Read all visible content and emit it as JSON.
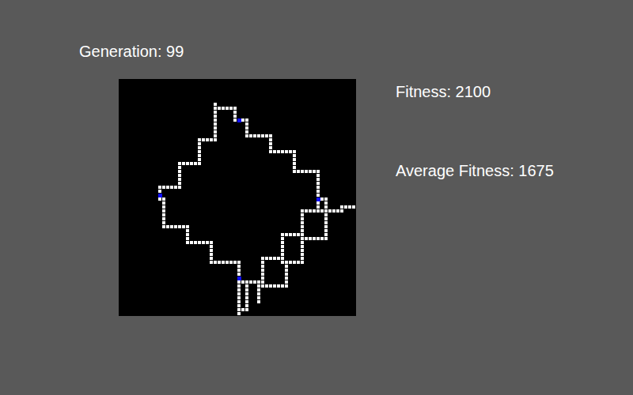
{
  "header": {
    "generation": "Generation: 99"
  },
  "stats": [
    {
      "label": "Fitness: 2100"
    },
    {
      "label": "Average Fitness: 1675"
    }
  ],
  "board": {
    "cols": 60,
    "rows": 60,
    "trails": [
      [
        [
          24,
          6
        ],
        [
          24,
          7
        ],
        [
          29,
          7
        ],
        [
          29,
          10
        ],
        [
          32,
          10
        ],
        [
          32,
          14
        ],
        [
          38,
          14
        ],
        [
          38,
          18
        ],
        [
          44,
          18
        ],
        [
          44,
          23
        ],
        [
          50,
          23
        ],
        [
          50,
          33
        ],
        [
          56,
          33
        ],
        [
          56,
          32
        ],
        [
          59,
          32
        ]
      ],
      [
        [
          24,
          7
        ],
        [
          24,
          15
        ],
        [
          20,
          15
        ],
        [
          20,
          21
        ],
        [
          15,
          21
        ],
        [
          15,
          27
        ],
        [
          10,
          27
        ],
        [
          10,
          30
        ],
        [
          11,
          30
        ],
        [
          11,
          37
        ],
        [
          17,
          37
        ],
        [
          17,
          41
        ],
        [
          23,
          41
        ],
        [
          23,
          46
        ],
        [
          30,
          46
        ],
        [
          30,
          51
        ]
      ],
      [
        [
          30,
          51
        ],
        [
          36,
          51
        ]
      ],
      [
        [
          30,
          51
        ],
        [
          30,
          59
        ]
      ],
      [
        [
          32,
          51
        ],
        [
          32,
          58
        ],
        [
          31,
          58
        ]
      ],
      [
        [
          35,
          51
        ],
        [
          35,
          56
        ]
      ],
      [
        [
          50,
          30
        ],
        [
          52,
          30
        ],
        [
          52,
          40
        ],
        [
          46,
          40
        ],
        [
          46,
          33
        ],
        [
          50,
          33
        ]
      ],
      [
        [
          46,
          40
        ],
        [
          46,
          46
        ],
        [
          41,
          46
        ],
        [
          41,
          39
        ],
        [
          46,
          39
        ]
      ],
      [
        [
          41,
          46
        ],
        [
          42,
          46
        ],
        [
          42,
          52
        ],
        [
          36,
          52
        ],
        [
          36,
          45
        ],
        [
          41,
          45
        ]
      ]
    ],
    "food": [
      [
        30,
        10
      ],
      [
        10,
        29
      ],
      [
        50,
        30
      ],
      [
        30,
        50
      ]
    ]
  }
}
